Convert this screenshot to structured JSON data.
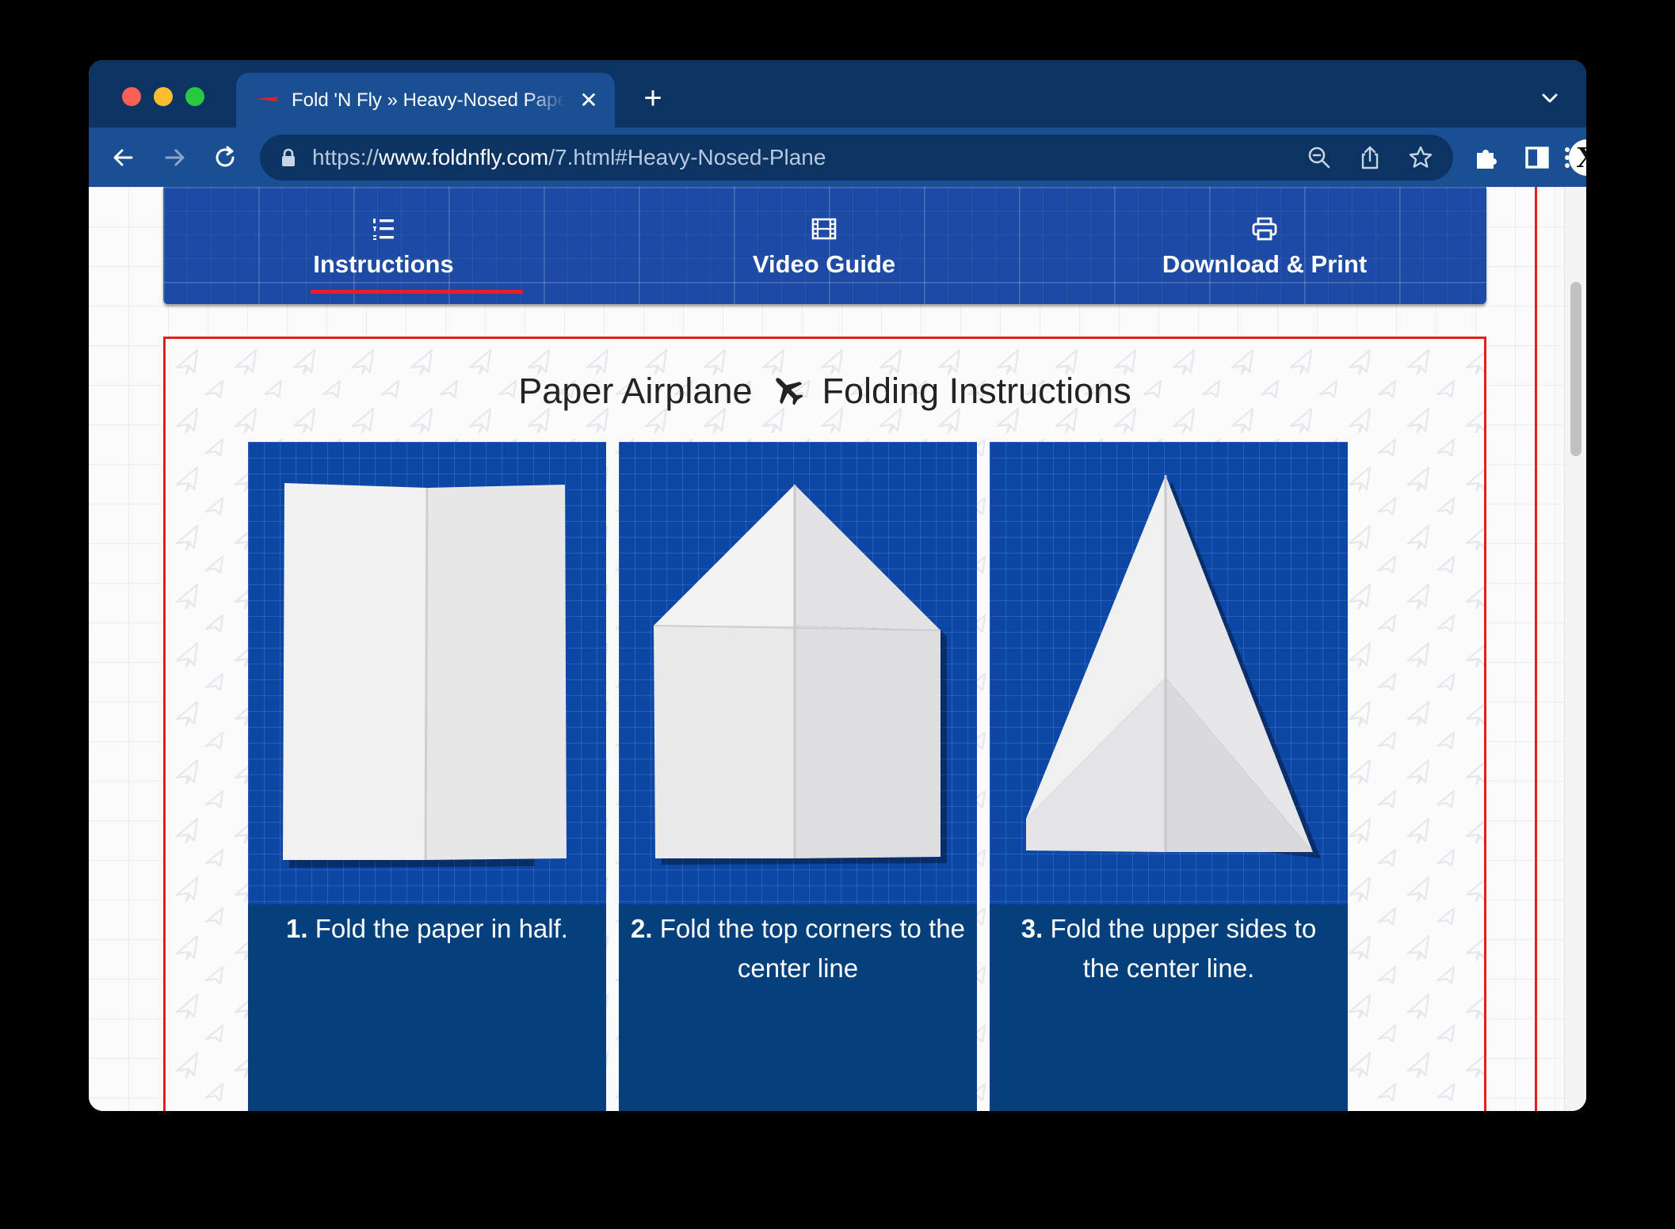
{
  "browser": {
    "tab_title": "Fold 'N Fly » Heavy-Nosed Paper Airplane",
    "tab_close": "✕",
    "new_tab": "+",
    "url_scheme": "https://",
    "url_host": "www.foldnfly.com",
    "url_path": "/7.html#Heavy-Nosed-Plane",
    "profile_initial": "X"
  },
  "nav": {
    "items": [
      {
        "label": "Instructions",
        "icon": "list-ordered-icon",
        "active": true
      },
      {
        "label": "Video Guide",
        "icon": "film-icon",
        "active": false
      },
      {
        "label": "Download & Print",
        "icon": "printer-icon",
        "active": false
      }
    ]
  },
  "instructions": {
    "heading_left": "Paper Airplane",
    "heading_right": "Folding Instructions",
    "steps": [
      {
        "number": "1.",
        "text": "Fold the paper in half."
      },
      {
        "number": "2.",
        "text": "Fold the top corners to the center line"
      },
      {
        "number": "3.",
        "text": "Fold the upper sides to the center line."
      }
    ]
  },
  "colors": {
    "chrome_dark": "#0c3462",
    "chrome_toolbar": "#1a4f93",
    "nav_blue": "#1d4aa4",
    "accent_red": "#e32124",
    "card_blue": "#06407c"
  }
}
